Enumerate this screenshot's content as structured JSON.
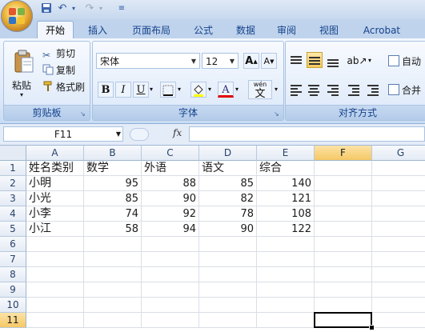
{
  "ribbon_tabs": [
    "开始",
    "插入",
    "页面布局",
    "公式",
    "数据",
    "审阅",
    "视图",
    "Acrobat"
  ],
  "active_tab": "开始",
  "clipboard": {
    "paste_label": "粘贴",
    "cut_label": "剪切",
    "copy_label": "复制",
    "format_painter_label": "格式刷",
    "group_label": "剪贴板"
  },
  "font": {
    "name": "宋体",
    "size": "12",
    "grow_label": "A",
    "shrink_label": "A",
    "bold_label": "B",
    "italic_label": "I",
    "underline_label": "U",
    "font_color_label": "A",
    "phonetic_label": "wén",
    "phonetic_char": "文",
    "group_label": "字体"
  },
  "alignment": {
    "wrap_label": "自动",
    "merge_label": "合并",
    "group_label": "对齐方式"
  },
  "formula_bar": {
    "name_box": "F11",
    "fx_label": "fx",
    "value": ""
  },
  "sheet": {
    "columns": [
      "A",
      "B",
      "C",
      "D",
      "E",
      "F",
      "G"
    ],
    "rows": [
      "1",
      "2",
      "3",
      "4",
      "5",
      "6",
      "7",
      "8",
      "9",
      "10",
      "11"
    ],
    "selected_column": "F",
    "selected_row": "11",
    "headers": [
      "姓名类别",
      "数学",
      "外语",
      "语文",
      "综合"
    ],
    "data": [
      [
        "小明",
        "95",
        "88",
        "85",
        "140"
      ],
      [
        "小光",
        "85",
        "90",
        "82",
        "121"
      ],
      [
        "小李",
        "74",
        "92",
        "78",
        "108"
      ],
      [
        "小江",
        "58",
        "94",
        "90",
        "122"
      ]
    ]
  }
}
